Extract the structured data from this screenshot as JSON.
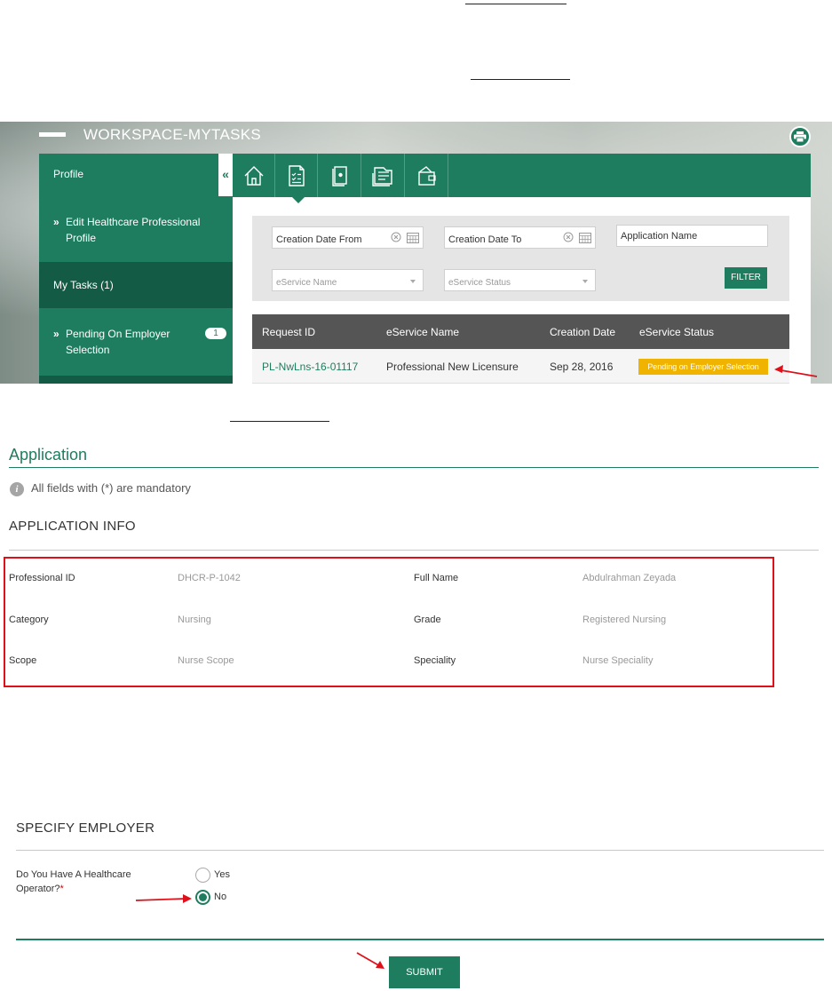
{
  "workspace": {
    "title": "WORKSPACE-MYTASKS",
    "sidebar": {
      "profile": "Profile",
      "collapse": "«",
      "edit_profile": "Edit Healthcare Professional Profile",
      "my_tasks": "My Tasks (1)",
      "pending": "Pending On Employer Selection",
      "pending_count": "1"
    },
    "tabs": [
      "home-icon",
      "tasks-icon",
      "document-icon",
      "folders-icon",
      "wallet-icon"
    ],
    "filters": {
      "creation_from": "Creation Date From",
      "creation_to": "Creation Date To",
      "application_name": "Application Name",
      "eservice_name": "eService Name",
      "eservice_status": "eService Status",
      "filter_button": "FILTER"
    },
    "table": {
      "columns": [
        "Request ID",
        "eService Name",
        "Creation Date",
        "eService Status"
      ],
      "rows": [
        {
          "request_id": "PL-NwLns-16-01117",
          "eservice_name": "Professional New Licensure",
          "creation_date": "Sep 28, 2016",
          "status": "Pending on Employer Selection"
        }
      ]
    }
  },
  "application": {
    "title": "Application",
    "mandatory_note": "All fields with (*) are mandatory",
    "section_title": "APPLICATION INFO",
    "fields": [
      {
        "label": "Professional ID",
        "value": "DHCR-P-1042"
      },
      {
        "label": "Full Name",
        "value": "Abdulrahman Zeyada"
      },
      {
        "label": "Category",
        "value": "Nursing"
      },
      {
        "label": "Grade",
        "value": "Registered Nursing"
      },
      {
        "label": "Scope",
        "value": "Nurse Scope"
      },
      {
        "label": "Speciality",
        "value": "Nurse Speciality"
      }
    ]
  },
  "employer": {
    "section_title": "SPECIFY EMPLOYER",
    "question": "Do You Have A Healthcare Operator?",
    "required_mark": "*",
    "options": [
      "Yes",
      "No"
    ],
    "selected": "No",
    "submit": "SUBMIT"
  },
  "colors": {
    "brand_green": "#1e7d5f",
    "status_yellow": "#f0b400",
    "annotation_red": "#e0101a"
  }
}
